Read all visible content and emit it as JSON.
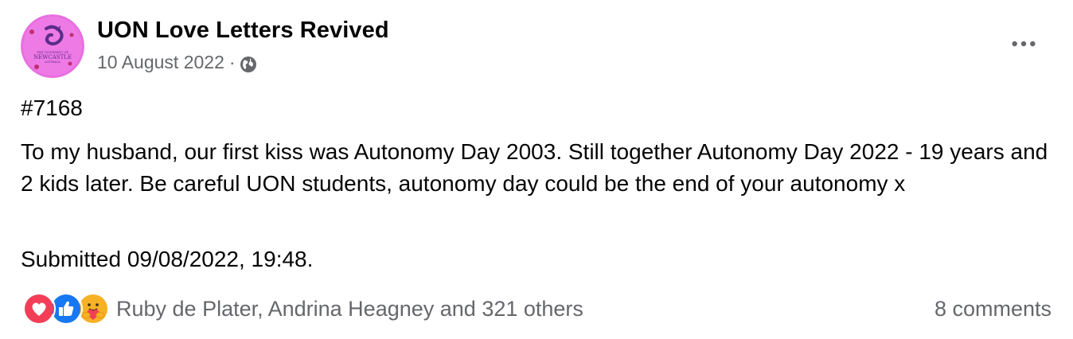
{
  "header": {
    "page_name": "UON Love Letters Revived",
    "date": "10 August 2022",
    "separator": "·",
    "privacy_icon": "globe-icon",
    "avatar_text_top": "THE UNIVERSITY OF",
    "avatar_text_main": "NEWCASTLE",
    "avatar_text_bottom": "AUSTRALIA",
    "more_icon": "more-options-icon"
  },
  "post": {
    "number": "#7168",
    "message": "To my husband, our first kiss was Autonomy Day 2003. Still together Autonomy Day 2022 - 19 years and 2 kids later. Be careful UON students, autonomy day could be the end of your autonomy x",
    "submitted": "Submitted 09/08/2022, 19:48."
  },
  "footer": {
    "reaction_icons": [
      "love-reaction-icon",
      "like-reaction-icon",
      "care-reaction-icon"
    ],
    "reactors": "Ruby de Plater, Andrina Heagney and 321 others",
    "comments": "8 comments"
  },
  "colors": {
    "text_primary": "#050505",
    "text_secondary": "#65676b",
    "like_blue": "#1877f2",
    "love_red": "#f33e58",
    "care_yellow": "#f7b125",
    "avatar_pink": "#e86fe0"
  }
}
